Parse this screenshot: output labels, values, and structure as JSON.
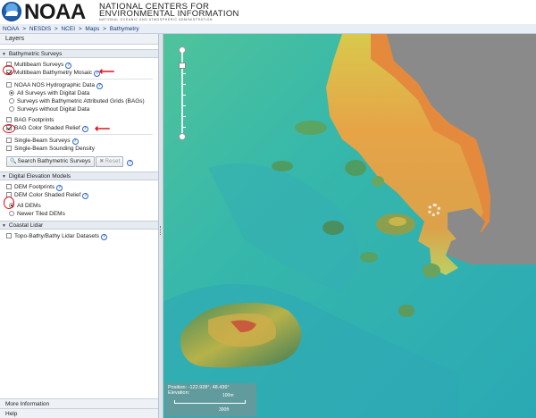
{
  "header": {
    "brand": "NOAA",
    "ncei_line1": "NATIONAL CENTERS FOR",
    "ncei_line2": "ENVIRONMENTAL INFORMATION",
    "ncei_sub": "NATIONAL OCEANIC AND ATMOSPHERIC ADMINISTRATION"
  },
  "breadcrumb": [
    "NOAA",
    ">",
    "NESDIS",
    ">",
    "NCEI",
    ">",
    "Maps",
    ">",
    "Bathymetry"
  ],
  "panel": {
    "title": "Layers",
    "sections": {
      "bathymetric": {
        "title": "Bathymetric Surveys",
        "multibeam_surveys": "Multibeam Surveys",
        "multibeam_mosaic": "Multibeam Bathymetry Mosaic",
        "nos_data": "NOAA NOS Hydrographic Data",
        "opt_all_digital": "All Surveys with Digital Data",
        "opt_bags": "Surveys with Bathymetric Attributed Grids (BAGs)",
        "opt_no_digital": "Surveys without Digital Data",
        "bag_footprints": "BAG Footprints",
        "bag_relief": "BAG Color Shaded Relief",
        "single_beam_surveys": "Single-Beam Surveys",
        "single_beam_density": "Single-Beam Sounding Density",
        "search_button": "Search Bathymetric Surveys",
        "reset_button": "Reset"
      },
      "dem": {
        "title": "Digital Elevation Models",
        "dem_footprints": "DEM Footprints",
        "dem_relief": "DEM Color Shaded Relief",
        "opt_all_dems": "All DEMs",
        "opt_newer": "Newer Tiled DEMs"
      },
      "lidar": {
        "title": "Coastal Lidar",
        "topo_bathy": "Topo-Bathy/Bathy Lidar Datasets"
      }
    },
    "footer": {
      "more_info": "More Information",
      "help": "Help"
    }
  },
  "state": {
    "multibeam_surveys": false,
    "multibeam_mosaic": true,
    "nos_data": false,
    "nos_option": "all_digital",
    "bag_footprints": false,
    "bag_relief": true,
    "single_beam_surveys": false,
    "single_beam_density": false,
    "dem_footprints": false,
    "dem_relief": false,
    "dem_option": "all_dems",
    "topo_bathy": false
  },
  "map": {
    "position_label": "Position: -122.928°, 48.436°",
    "elevation_label": "Elevation:",
    "scale_top": "100m",
    "scale_bottom": "300ft",
    "colors": {
      "deep": "#2eb1b4",
      "shallow": "#56c79a",
      "mid": "#c9d36a",
      "high": "#e89a3a",
      "peak": "#c8453a",
      "land": "#8a8a8a"
    }
  },
  "icons": {
    "info": "i",
    "search": "search-icon",
    "reset": "reset-icon"
  },
  "annotations": {
    "color": "#e0141e"
  }
}
